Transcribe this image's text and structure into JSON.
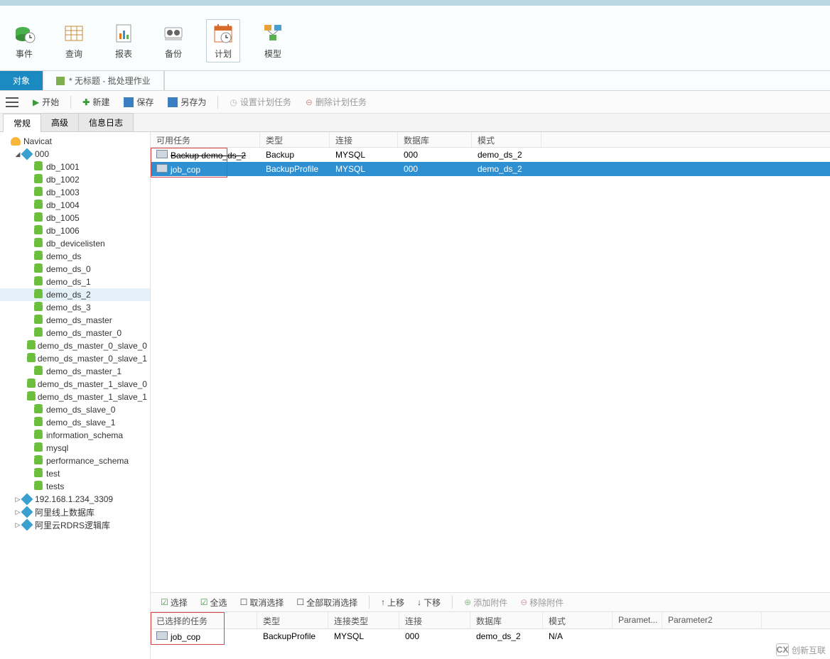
{
  "ribbon": [
    {
      "label": "事件",
      "name": "event-button"
    },
    {
      "label": "查询",
      "name": "query-button"
    },
    {
      "label": "报表",
      "name": "report-button"
    },
    {
      "label": "备份",
      "name": "backup-button"
    },
    {
      "label": "计划",
      "name": "schedule-button",
      "active": true
    },
    {
      "label": "模型",
      "name": "model-button"
    }
  ],
  "tabs": {
    "object": "对象",
    "untitled": "* 无标题 - 批处理作业"
  },
  "toolbar": {
    "start": "开始",
    "new": "新建",
    "save": "保存",
    "saveAs": "另存为",
    "setSchedule": "设置计划任务",
    "deleteSchedule": "删除计划任务"
  },
  "subTabs": {
    "general": "常规",
    "advanced": "高级",
    "messageLog": "信息日志"
  },
  "tree": {
    "root": "Navicat",
    "conn000": "000",
    "databases": [
      "db_1001",
      "db_1002",
      "db_1003",
      "db_1004",
      "db_1005",
      "db_1006",
      "db_devicelisten",
      "demo_ds",
      "demo_ds_0",
      "demo_ds_1",
      "demo_ds_2",
      "demo_ds_3",
      "demo_ds_master",
      "demo_ds_master_0",
      "demo_ds_master_0_slave_0",
      "demo_ds_master_0_slave_1",
      "demo_ds_master_1",
      "demo_ds_master_1_slave_0",
      "demo_ds_master_1_slave_1",
      "demo_ds_slave_0",
      "demo_ds_slave_1",
      "information_schema",
      "mysql",
      "performance_schema",
      "test",
      "tests"
    ],
    "selectedDb": "demo_ds_2",
    "otherConns": [
      "192.168.1.234_3309",
      "阿里线上数据库",
      "阿里云RDRS逻辑库"
    ]
  },
  "availableTasks": {
    "header": {
      "task": "可用任务",
      "type": "类型",
      "conn": "连接",
      "db": "数据库",
      "mode": "模式"
    },
    "rows": [
      {
        "task": "Backup demo_ds_2",
        "type": "Backup",
        "conn": "MYSQL",
        "db": "000",
        "mode": "demo_ds_2",
        "strike": true
      },
      {
        "task": "job_cop",
        "type": "BackupProfile",
        "conn": "MYSQL",
        "db": "000",
        "mode": "demo_ds_2",
        "selected": true
      }
    ]
  },
  "selToolbar": {
    "select": "选择",
    "selectAll": "全选",
    "deselect": "取消选择",
    "deselectAll": "全部取消选择",
    "up": "上移",
    "down": "下移",
    "addAttach": "添加附件",
    "removeAttach": "移除附件"
  },
  "selectedTasks": {
    "header": {
      "task": "已选择的任务",
      "type": "类型",
      "ctype": "连接类型",
      "conn": "连接",
      "db": "数据库",
      "mode": "模式",
      "p1": "Paramet...",
      "p2": "Parameter2"
    },
    "rows": [
      {
        "task": "job_cop",
        "type": "BackupProfile",
        "ctype": "MYSQL",
        "conn": "000",
        "db": "demo_ds_2",
        "mode": "N/A",
        "p1": "",
        "p2": ""
      }
    ]
  },
  "watermark": "创新互联"
}
